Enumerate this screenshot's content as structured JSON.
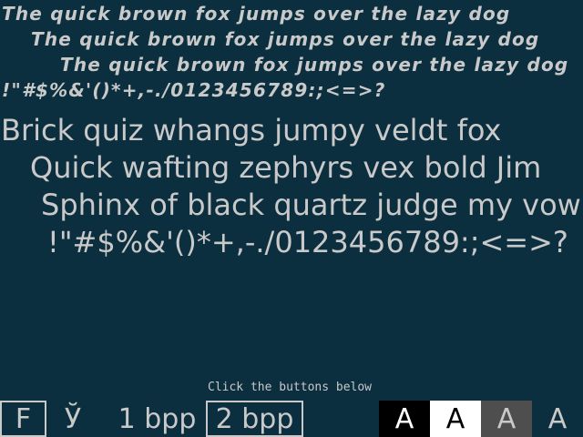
{
  "sample_small": {
    "line1": "The quick brown fox jumps over the lazy dog",
    "line2": "The quick brown fox jumps over the lazy dog",
    "line3": "The quick brown fox jumps over the lazy dog",
    "line4": "!\"#$%&'()*+,-./0123456789:;<=>?"
  },
  "sample_large": {
    "line1": "Brick quiz whangs jumpy veldt fox",
    "line2": "Quick wafting zephyrs vex bold Jim",
    "line3": "Sphinx of black quartz judge my vow",
    "line4": "!\"#$%&'()*+,-./0123456789:;<=>?"
  },
  "hint": "Click the buttons below",
  "toolbar": {
    "font_label": "F",
    "script_label": "Ў",
    "bpp1_label": "1 bpp",
    "bpp2_label": "2 bpp",
    "swatches": [
      {
        "label": "A",
        "bg": "#000000",
        "fg": "#ffffff"
      },
      {
        "label": "A",
        "bg": "#ffffff",
        "fg": "#000000"
      },
      {
        "label": "A",
        "bg": "#4e4e4e",
        "fg": "#c9c9c9"
      },
      {
        "label": "A",
        "bg": "#0b2f3f",
        "fg": "#c9c9c9"
      }
    ]
  },
  "colors": {
    "background": "#0b2f3f",
    "text": "#c9c9c9"
  }
}
